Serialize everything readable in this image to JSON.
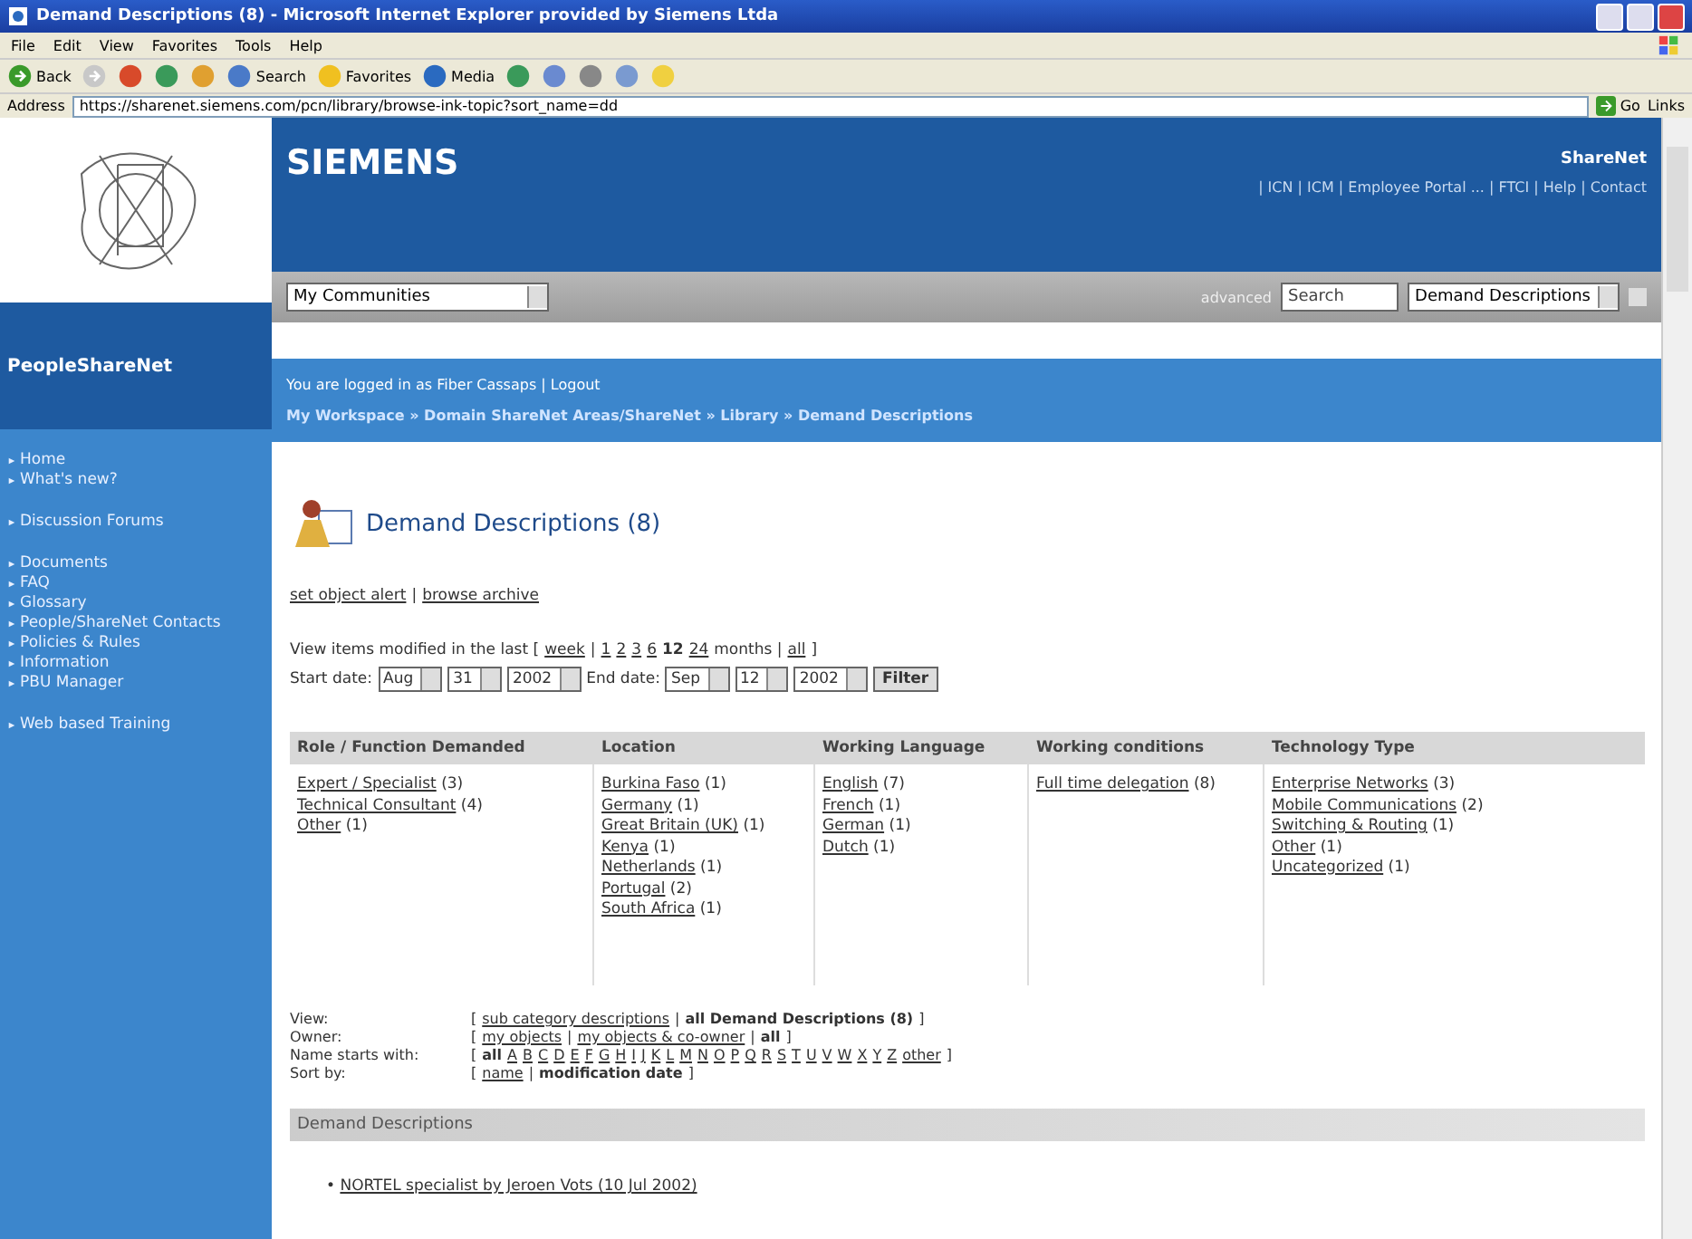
{
  "window": {
    "title": "Demand Descriptions (8) - Microsoft Internet Explorer provided by Siemens Ltda"
  },
  "menu": [
    "File",
    "Edit",
    "View",
    "Favorites",
    "Tools",
    "Help"
  ],
  "toolbar": [
    {
      "kind": "back",
      "label": "Back"
    },
    {
      "kind": "forward"
    },
    {
      "kind": "stop"
    },
    {
      "kind": "refresh"
    },
    {
      "kind": "home"
    },
    {
      "kind": "search",
      "label": "Search"
    },
    {
      "kind": "favorites",
      "label": "Favorites"
    },
    {
      "kind": "media",
      "label": "Media"
    },
    {
      "kind": "history"
    },
    {
      "kind": "mail"
    },
    {
      "kind": "print"
    },
    {
      "kind": "edit"
    },
    {
      "kind": "messenger"
    }
  ],
  "address": {
    "label": "Address",
    "value": "https://sharenet.siemens.com/pcn/library/browse-ink-topic?sort_name=dd",
    "go": "Go",
    "links": "Links"
  },
  "header": {
    "brand": "SIEMENS",
    "site": "ShareNet",
    "links": "| ICN | ICM | Employee Portal ... | FTCI | Help | Contact",
    "community": "My Communities",
    "advanced": "advanced",
    "search_placeholder": "Search",
    "scope": "Demand Descriptions"
  },
  "sidebar": {
    "title": "PeopleShareNet",
    "groups": [
      [
        "Home",
        "What's new?"
      ],
      [
        "Discussion Forums"
      ],
      [
        "Documents",
        "FAQ",
        "Glossary",
        "People/ShareNet Contacts",
        "Policies & Rules",
        "Information",
        "PBU Manager"
      ],
      [
        "Web based Training"
      ]
    ]
  },
  "session": "You are logged in as Fiber Cassaps | Logout",
  "breadcrumb": "My Workspace » Domain ShareNet Areas/ShareNet » Library » Demand Descriptions",
  "page_title": "Demand Descriptions (8)",
  "actions": [
    {
      "text": "set object alert",
      "kind": "link"
    },
    {
      "text": "|",
      "kind": "text"
    },
    {
      "text": "browse archive",
      "kind": "link"
    }
  ],
  "period": [
    {
      "text": "View items modified in the last [",
      "kind": "text"
    },
    {
      "text": "week",
      "kind": "link"
    },
    {
      "text": "|",
      "kind": "text"
    },
    {
      "text": "1",
      "kind": "link"
    },
    {
      "text": "2",
      "kind": "link"
    },
    {
      "text": "3",
      "kind": "link"
    },
    {
      "text": "6",
      "kind": "link"
    },
    {
      "text": "12",
      "kind": "bold"
    },
    {
      "text": "24",
      "kind": "link"
    },
    {
      "text": "months |",
      "kind": "text"
    },
    {
      "text": "all",
      "kind": "link"
    },
    {
      "text": "]",
      "kind": "text"
    }
  ],
  "dates": {
    "start_label": "Start date:",
    "start": [
      "Aug",
      "31",
      "2002"
    ],
    "end_label": "End date:",
    "end": [
      "Sep",
      "12",
      "2002"
    ],
    "filter": "Filter"
  },
  "table": {
    "columns": [
      "Role / Function Demanded",
      "Location",
      "Working Language",
      "Working conditions",
      "Technology Type"
    ],
    "cells": [
      [
        {
          "link": "Expert / Specialist",
          "count": "(3)"
        },
        {
          "link": "Technical Consultant",
          "count": "(4)"
        },
        {
          "link": "Other",
          "count": "(1)"
        }
      ],
      [
        {
          "link": "Burkina Faso",
          "count": "(1)"
        },
        {
          "link": "Germany",
          "count": "(1)"
        },
        {
          "link": "Great Britain (UK)",
          "count": "(1)"
        },
        {
          "link": "Kenya",
          "count": "(1)"
        },
        {
          "link": "Netherlands",
          "count": "(1)"
        },
        {
          "link": "Portugal",
          "count": "(2)"
        },
        {
          "link": "South Africa",
          "count": "(1)"
        }
      ],
      [
        {
          "link": "English",
          "count": "(7)"
        },
        {
          "link": "French",
          "count": "(1)"
        },
        {
          "link": "German",
          "count": "(1)"
        },
        {
          "link": "Dutch",
          "count": "(1)"
        }
      ],
      [
        {
          "link": "Full time delegation",
          "count": "(8)"
        }
      ],
      [
        {
          "link": "Enterprise Networks",
          "count": "(3)"
        },
        {
          "link": "Mobile Communications",
          "count": "(2)"
        },
        {
          "link": "Switching & Routing",
          "count": "(1)"
        },
        {
          "link": "Other",
          "count": "(1)"
        },
        {
          "link": "Uncategorized",
          "count": "(1)"
        }
      ]
    ]
  },
  "filters": [
    {
      "label": "View:",
      "open": "[",
      "close": "]",
      "separator": "|",
      "options": [
        {
          "label": "sub category descriptions",
          "selected": false
        },
        {
          "label": "all Demand Descriptions (8)",
          "selected": true
        }
      ]
    },
    {
      "label": "Owner:",
      "open": "[",
      "close": "]",
      "separator": "|",
      "options": [
        {
          "label": "my objects",
          "selected": false
        },
        {
          "label": "my objects & co-owner",
          "selected": false
        },
        {
          "label": "all",
          "selected": true
        }
      ]
    },
    {
      "label": "Name starts with:",
      "open": "[",
      "close": "]",
      "options": [
        {
          "label": "all",
          "selected": true
        },
        {
          "label": "A",
          "selected": false
        },
        {
          "label": "B",
          "selected": false
        },
        {
          "label": "C",
          "selected": false
        },
        {
          "label": "D",
          "selected": false
        },
        {
          "label": "E",
          "selected": false
        },
        {
          "label": "F",
          "selected": false
        },
        {
          "label": "G",
          "selected": false
        },
        {
          "label": "H",
          "selected": false
        },
        {
          "label": "I",
          "selected": false
        },
        {
          "label": "J",
          "selected": false
        },
        {
          "label": "K",
          "selected": false
        },
        {
          "label": "L",
          "selected": false
        },
        {
          "label": "M",
          "selected": false
        },
        {
          "label": "N",
          "selected": false
        },
        {
          "label": "O",
          "selected": false
        },
        {
          "label": "P",
          "selected": false
        },
        {
          "label": "Q",
          "selected": false
        },
        {
          "label": "R",
          "selected": false
        },
        {
          "label": "S",
          "selected": false
        },
        {
          "label": "T",
          "selected": false
        },
        {
          "label": "U",
          "selected": false
        },
        {
          "label": "V",
          "selected": false
        },
        {
          "label": "W",
          "selected": false
        },
        {
          "label": "X",
          "selected": false
        },
        {
          "label": "Y",
          "selected": false
        },
        {
          "label": "Z",
          "selected": false
        },
        {
          "label": "other",
          "selected": false
        }
      ]
    },
    {
      "label": "Sort by:",
      "open": "[",
      "close": "]",
      "separator": "|",
      "options": [
        {
          "label": "name",
          "selected": false
        },
        {
          "label": "modification date",
          "selected": true
        }
      ]
    }
  ],
  "list": {
    "title": "Demand Descriptions",
    "bullet": "•",
    "items": [
      "NORTEL specialist by Jeroen Vots (10 Jul 2002)"
    ]
  }
}
